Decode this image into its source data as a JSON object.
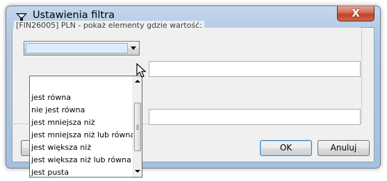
{
  "window": {
    "title": "Ustawienia filtra",
    "close_glyph": "X",
    "icons": {
      "app": "filter-funnel-icon",
      "close": "close-icon",
      "cursor": "mouse-pointer-icon"
    }
  },
  "group": {
    "label": "[FIN26005] PLN - pokaż elementy gdzie wartość:"
  },
  "condition1": {
    "selected": "",
    "value": ""
  },
  "condition2": {
    "value": ""
  },
  "dropdown": {
    "options": [
      "jest równa",
      "nie jest równa",
      "jest mniejsza niż",
      "jest mniejsza niż lub równa",
      "jest większa niż",
      "jest większa niż lub równa",
      "jest pusta"
    ],
    "scroll_position": 0.3
  },
  "buttons": {
    "ok": "OK",
    "cancel": "Anuluj"
  },
  "colors": {
    "title_bar": "#b7cde6",
    "close_button": "#c2402a",
    "selection_highlight": "#dcecfc",
    "dialog_background": "#f0f0f0"
  }
}
